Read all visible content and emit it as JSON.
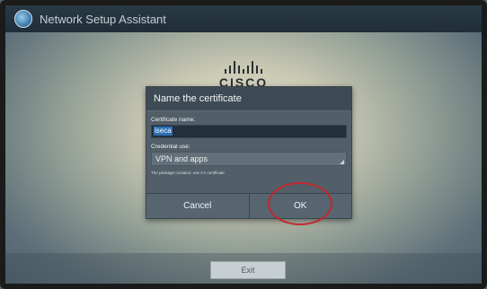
{
  "app": {
    "title": "Network Setup Assistant",
    "icon": "network-globe-icon"
  },
  "logo": {
    "text": "CISCO",
    "icon": "cisco-bars-icon"
  },
  "dialog": {
    "title": "Name the certificate",
    "cert_name_label": "Certificate name:",
    "cert_name_value": "iseca",
    "credential_label": "Credential use:",
    "credential_value": "VPN and apps",
    "note": "The package contains: one CA certificate",
    "cancel_label": "Cancel",
    "ok_label": "OK"
  },
  "footer": {
    "exit_label": "Exit"
  },
  "colors": {
    "highlight_ring": "#c4262e",
    "selection": "#2d6fb7"
  }
}
